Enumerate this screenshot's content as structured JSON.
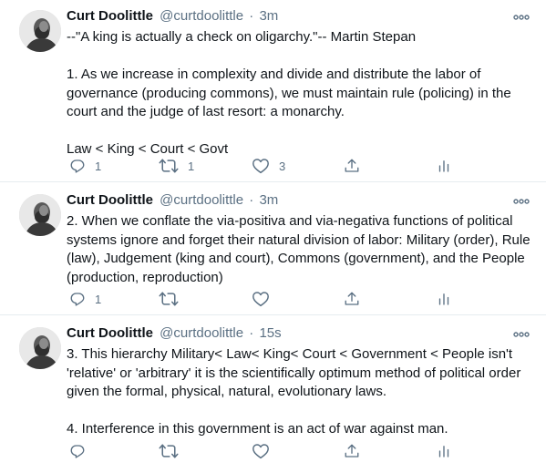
{
  "tweets": [
    {
      "author_name": "Curt Doolittle",
      "handle": "@curtdoolittle",
      "separator": "·",
      "time": "3m",
      "paragraphs": [
        "--\"A king is actually a check on oligarchy.\"-- Martin Stepan",
        "1. As we increase in complexity and divide and distribute the labor of governance (producing commons), we must maintain rule (policing) in the court and the judge of last resort: a monarchy.",
        "Law < King < Court < Govt"
      ],
      "reply_count": "1",
      "retweet_count": "1",
      "like_count": "3"
    },
    {
      "author_name": "Curt Doolittle",
      "handle": "@curtdoolittle",
      "separator": "·",
      "time": "3m",
      "paragraphs": [
        "2. When we conflate the via-positiva and via-negativa functions of political systems ignore and forget their natural division of labor: Military (order), Rule (law), Judgement (king and court), Commons (government), and the People (production, reproduction)"
      ],
      "reply_count": "1",
      "retweet_count": "",
      "like_count": ""
    },
    {
      "author_name": "Curt Doolittle",
      "handle": "@curtdoolittle",
      "separator": "·",
      "time": "15s",
      "paragraphs": [
        "3. This hierarchy Military< Law< King< Court < Government < People isn't 'relative' or 'arbitrary' it is the scientifically optimum method of political order given the formal, physical, natural, evolutionary laws.",
        "4. Interference in this government is an act of war against man."
      ],
      "reply_count": "",
      "retweet_count": "",
      "like_count": ""
    }
  ],
  "icons": {
    "more": "more-horizontal-icon",
    "reply": "reply-icon",
    "retweet": "retweet-icon",
    "like": "heart-icon",
    "share": "share-icon",
    "analytics": "analytics-icon"
  },
  "colors": {
    "text": "#0f1419",
    "secondary": "#5b7083",
    "divider": "#e6ecf0",
    "background": "#ffffff"
  }
}
